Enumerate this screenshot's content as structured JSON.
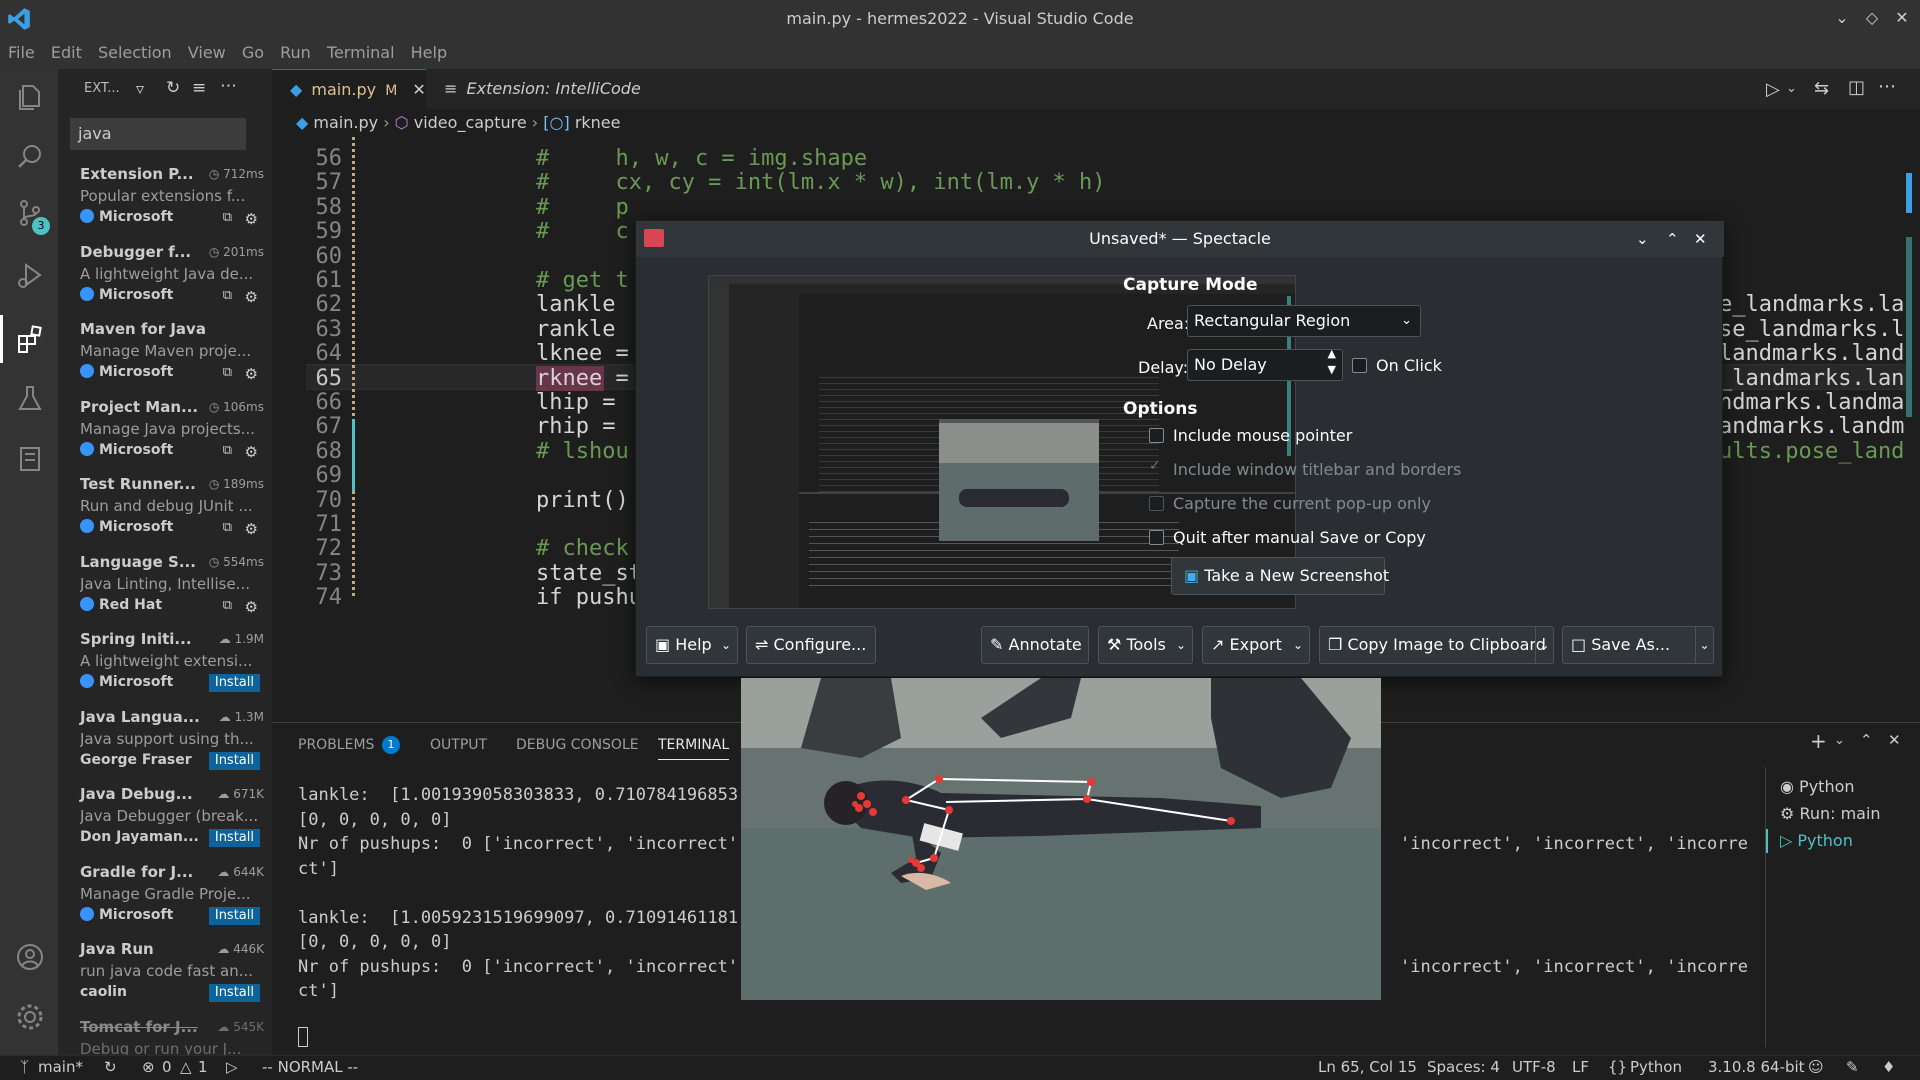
{
  "window": {
    "title": "main.py - hermes2022 - Visual Studio Code"
  },
  "menu": [
    "File",
    "Edit",
    "Selection",
    "View",
    "Go",
    "Run",
    "Terminal",
    "Help"
  ],
  "activity": {
    "scm_badge": "3"
  },
  "sidebar": {
    "header": "EXT...",
    "search_value": "java",
    "extensions": [
      {
        "name": "Extension P...",
        "stat": "712ms",
        "desc": "Popular extensions f...",
        "publisher": "Microsoft",
        "verified": true,
        "action": "gear"
      },
      {
        "name": "Debugger f...",
        "stat": "201ms",
        "desc": "A lightweight Java de...",
        "publisher": "Microsoft",
        "verified": true,
        "action": "gear"
      },
      {
        "name": "Maven for Java",
        "stat": "",
        "desc": "Manage Maven proje...",
        "publisher": "Microsoft",
        "verified": true,
        "action": "gear"
      },
      {
        "name": "Project Man...",
        "stat": "106ms",
        "desc": "Manage Java projects...",
        "publisher": "Microsoft",
        "verified": true,
        "action": "gear"
      },
      {
        "name": "Test Runner...",
        "stat": "189ms",
        "desc": "Run and debug JUnit ...",
        "publisher": "Microsoft",
        "verified": true,
        "action": "gear"
      },
      {
        "name": "Language S...",
        "stat": "554ms",
        "desc": "Java Linting, Intellise...",
        "publisher": "Red Hat",
        "verified": true,
        "action": "gear"
      },
      {
        "name": "Spring Initi...",
        "stat": "1.9M",
        "desc": "A lightweight extensi...",
        "publisher": "Microsoft",
        "verified": true,
        "action": "Install"
      },
      {
        "name": "Java Langua...",
        "stat": "1.3M",
        "desc": "Java support using th...",
        "publisher": "George Fraser",
        "verified": false,
        "action": "Install"
      },
      {
        "name": "Java Debug...",
        "stat": "671K",
        "desc": "Java Debugger (break...",
        "publisher": "Don Jayaman...",
        "verified": false,
        "action": "Install"
      },
      {
        "name": "Gradle for J...",
        "stat": "644K",
        "desc": "Manage Gradle Proje...",
        "publisher": "Microsoft",
        "verified": true,
        "action": "Install"
      },
      {
        "name": "Java Run",
        "stat": "446K",
        "desc": "run java code fast an...",
        "publisher": "caolin",
        "verified": false,
        "action": "Install"
      },
      {
        "name": "Tomcat for J...",
        "stat": "545K",
        "desc": "Debug or run your J...",
        "publisher": "",
        "verified": false,
        "action": ""
      }
    ]
  },
  "tabs": [
    {
      "label": "main.py",
      "modified": "M",
      "active": true
    },
    {
      "label": "Extension: IntelliCode",
      "active": false
    }
  ],
  "breadcrumbs": [
    "main.py",
    "video_capture",
    "rknee"
  ],
  "code": {
    "lines": [
      {
        "n": "56",
        "text": "#     h, w, c = img.shape",
        "comment": true
      },
      {
        "n": "57",
        "text": "#     cx, cy = int(lm.x * w), int(lm.y * h)",
        "comment": true
      },
      {
        "n": "58",
        "text": "#     p",
        "comment": true
      },
      {
        "n": "59",
        "text": "#     c",
        "comment": true
      },
      {
        "n": "60",
        "text": "",
        "comment": false
      },
      {
        "n": "61",
        "text": "# get t",
        "comment": true
      },
      {
        "n": "62",
        "text": "lankle ",
        "comment": false
      },
      {
        "n": "63",
        "text": "rankle ",
        "comment": false
      },
      {
        "n": "64",
        "text": "lknee =",
        "comment": false
      },
      {
        "n": "65",
        "text": "rknee =",
        "comment": false
      },
      {
        "n": "66",
        "text": "lhip =",
        "comment": false
      },
      {
        "n": "67",
        "text": "rhip =",
        "comment": false
      },
      {
        "n": "68",
        "text": "# lshou",
        "comment": true
      },
      {
        "n": "69",
        "text": "",
        "comment": false
      },
      {
        "n": "70",
        "text": "print()",
        "comment": false
      },
      {
        "n": "71",
        "text": "",
        "comment": false
      },
      {
        "n": "72",
        "text": "# check",
        "comment": true
      },
      {
        "n": "73",
        "text": "state_stack.app",
        "comment": false
      },
      {
        "n": "74",
        "text": "if pushup_check",
        "comment": false
      }
    ],
    "right_fragments": [
      "e_landmarks.la",
      "se_landmarks.l",
      "landmarks.land",
      "_landmarks.lan",
      "ndmarks.landma",
      "andmarks.landm",
      "ults.pose_land"
    ]
  },
  "panel": {
    "tabs": [
      "PROBLEMS",
      "OUTPUT",
      "DEBUG CONSOLE",
      "TERMINAL"
    ],
    "problems_count": "1",
    "terminal_lines": [
      "lankle:  [1.001939058303833, 0.710784196853",
      "[0, 0, 0, 0, 0]",
      "Nr of pushups:  0 ['incorrect', 'incorrect',",
      "ct']",
      "",
      "lankle:  [1.0059231519699097, 0.71091461181",
      "[0, 0, 0, 0, 0]",
      "Nr of pushups:  0 ['incorrect', 'incorrect',",
      "ct']"
    ],
    "terminal_right": [
      "'incorrect', 'incorrect', 'incorre",
      "'incorrect', 'incorrect', 'incorre"
    ],
    "terminal_list": [
      "Python",
      "Run: main",
      "Python"
    ]
  },
  "statusbar": {
    "branch": "main*",
    "errors": "0",
    "warnings": "1",
    "mode": "-- NORMAL --",
    "position": "Ln 65, Col 15",
    "spaces": "Spaces: 4",
    "encoding": "UTF-8",
    "eol": "LF",
    "language": "Python",
    "interpreter": "3.10.8 64-bit"
  },
  "spectacle": {
    "title": "Unsaved* — Spectacle",
    "capture_mode": "Capture Mode",
    "area_label": "Area:",
    "area_value": "Rectangular Region",
    "delay_label": "Delay:",
    "delay_value": "No Delay",
    "on_click": "On Click",
    "options": "Options",
    "opt_pointer": "Include mouse pointer",
    "opt_titlebar": "Include window titlebar and borders",
    "opt_popup": "Capture the current pop-up only",
    "opt_quit": "Quit after manual Save or Copy",
    "take_new": "Take a New Screenshot",
    "help": "Help",
    "configure": "Configure...",
    "annotate": "Annotate",
    "tools": "Tools",
    "export": "Export",
    "copy": "Copy Image to Clipboard",
    "save_as": "Save As..."
  },
  "colors": {
    "accent": "#007acc",
    "spectacle_bg": "#2a2e32",
    "pose_points": "#e53935"
  }
}
